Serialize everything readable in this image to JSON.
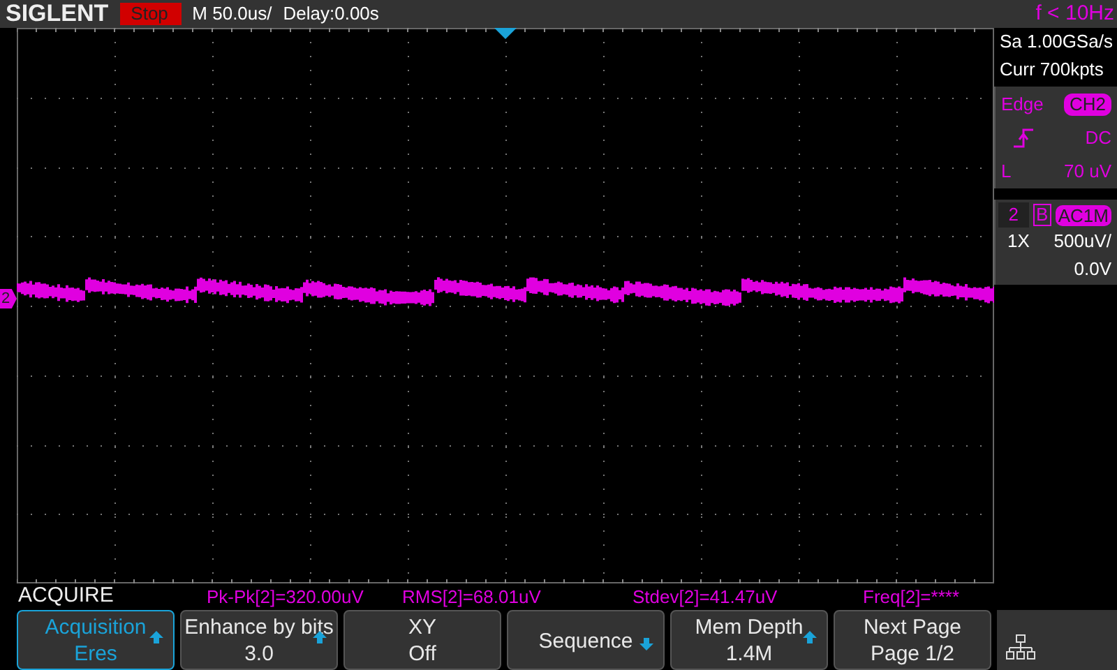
{
  "header": {
    "brand": "SIGLENT",
    "run_state": "Stop",
    "timebase": "M 50.0us/",
    "delay": "Delay:0.00s",
    "trigger_freq": "f < 10Hz"
  },
  "acquisition": {
    "sample_rate": "Sa 1.00GSa/s",
    "memory": "Curr 700kpts"
  },
  "trigger": {
    "type": "Edge",
    "source": "CH2",
    "coupling": "DC",
    "level_label": "L",
    "level": "70 uV"
  },
  "channel": {
    "number": "2",
    "bandwidth": "B",
    "coupling": "AC1M",
    "probe": "1X",
    "scale": "500uV/",
    "offset": "0.0V"
  },
  "channel_marker": "2",
  "menu_title": "ACQUIRE",
  "measurements": [
    "Pk-Pk[2]=320.00uV",
    "RMS[2]=68.01uV",
    "Stdev[2]=41.47uV",
    "Freq[2]=****"
  ],
  "softkeys": [
    {
      "label": "Acquisition",
      "value": "Eres",
      "kind": "increment",
      "selected": true
    },
    {
      "label": "Enhance by bits",
      "value": "3.0",
      "kind": "increment",
      "selected": false
    },
    {
      "label": "XY",
      "value": "Off",
      "kind": "plain",
      "selected": false
    },
    {
      "label": "Sequence",
      "kind": "decrement",
      "selected": false
    },
    {
      "label": "Mem Depth",
      "value": "1.4M",
      "kind": "increment",
      "selected": false
    },
    {
      "label": "Next Page",
      "value": "Page 1/2",
      "kind": "plain",
      "selected": false
    }
  ]
}
